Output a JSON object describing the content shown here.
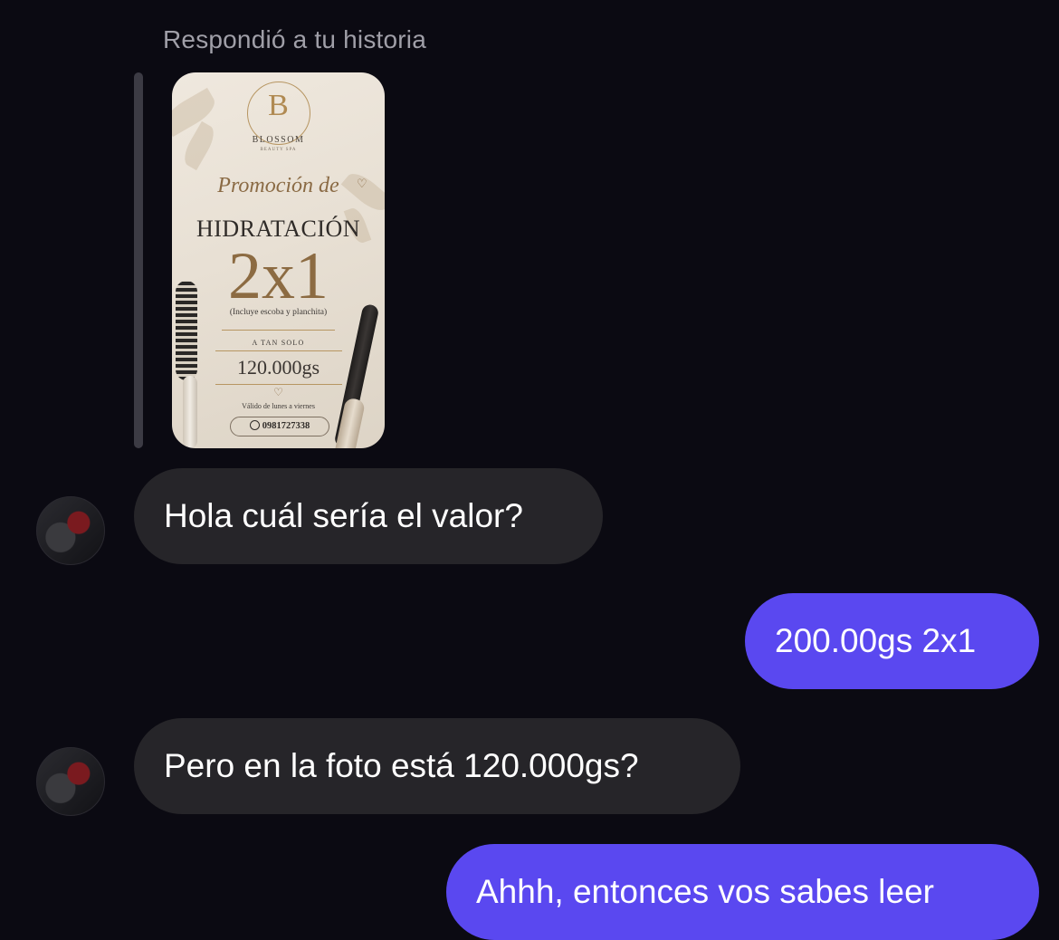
{
  "reply": {
    "label": "Respondió a tu historia"
  },
  "story": {
    "logo_letter": "B",
    "brand": "BLOSSOM",
    "brand_sub": "BEAUTY SPA",
    "promo_script": "Promoción de",
    "title": "HIDRATACIÓN",
    "big_offer": "2x1",
    "includes": "(Incluye escoba y planchita)",
    "a_tan_solo": "A TAN SOLO",
    "price": "120.000gs",
    "valid": "Válido de lunes a viernes",
    "phone": "0981727338"
  },
  "messages": [
    {
      "direction": "incoming",
      "text": "Hola cuál sería el valor?"
    },
    {
      "direction": "outgoing",
      "text": "200.00gs 2x1"
    },
    {
      "direction": "incoming",
      "text": "Pero en la foto está 120.000gs?"
    },
    {
      "direction": "outgoing",
      "text": "Ahhh, entonces vos sabes leer"
    }
  ],
  "colors": {
    "background": "#0b0a12",
    "incoming_bubble": "#262529",
    "outgoing_bubble": "#5a48f0",
    "muted_text": "#a09fa8"
  }
}
